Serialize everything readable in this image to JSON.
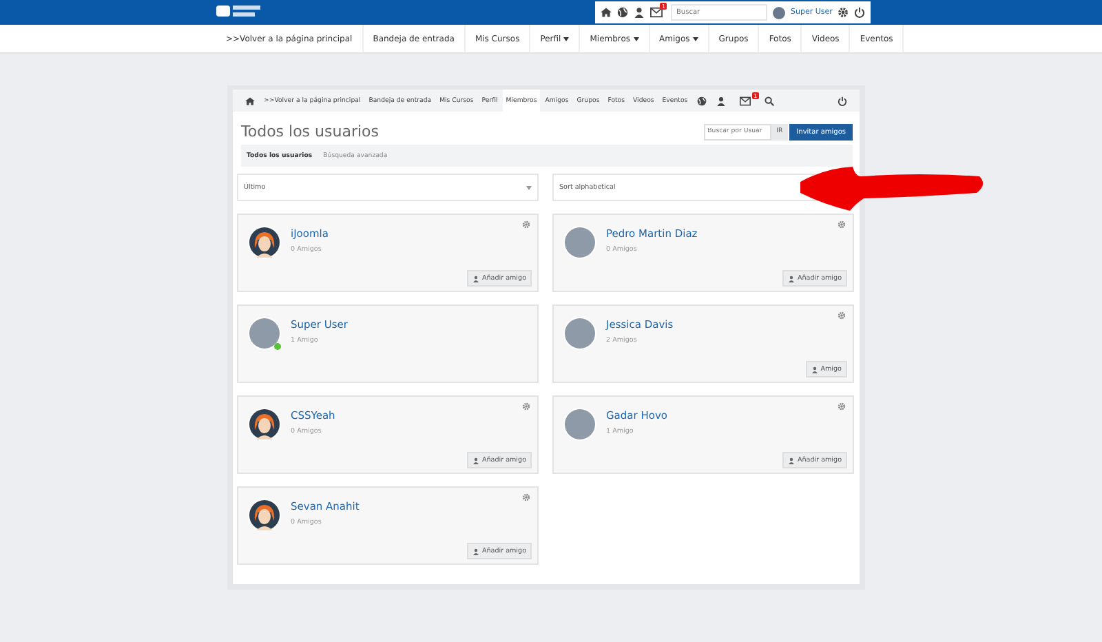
{
  "top_bar": {
    "search": {
      "placeholder": "Buscar"
    },
    "notification_count": "1",
    "user": "Super User"
  },
  "main_nav": [
    {
      "label": ">>Volver a la página principal",
      "caret": false
    },
    {
      "label": "Bandeja de entrada",
      "caret": false
    },
    {
      "label": "Mis Cursos",
      "caret": false
    },
    {
      "label": "Perfil",
      "caret": true
    },
    {
      "label": "Miembros",
      "caret": true
    },
    {
      "label": "Amigos",
      "caret": true
    },
    {
      "label": "Grupos",
      "caret": false
    },
    {
      "label": "Fotos",
      "caret": false
    },
    {
      "label": "Videos",
      "caret": false
    },
    {
      "label": "Eventos",
      "caret": false
    }
  ],
  "sub_nav": {
    "items": [
      {
        "label": ">>Volver a la página principal",
        "selected": false
      },
      {
        "label": "Bandeja de entrada",
        "selected": false
      },
      {
        "label": "Mis Cursos",
        "selected": false
      },
      {
        "label": "Perfil",
        "selected": false
      },
      {
        "label": "Miembros",
        "selected": true
      },
      {
        "label": "Amigos",
        "selected": false
      },
      {
        "label": "Grupos",
        "selected": false
      },
      {
        "label": "Fotos",
        "selected": false
      },
      {
        "label": "Videos",
        "selected": false
      },
      {
        "label": "Eventos",
        "selected": false
      }
    ],
    "notification_count": "1"
  },
  "page_title": "Todos los usuarios",
  "user_search": {
    "placeholder": "Buscar por Usuar",
    "go": "IR"
  },
  "invite_button": "Invitar amigos",
  "tabs": [
    {
      "label": "Todos los usuarios",
      "selected": true
    },
    {
      "label": "Búsqueda avanzada",
      "selected": false
    }
  ],
  "filters": [
    "Último",
    "Sort alphabetical"
  ],
  "members": [
    {
      "name": "iJoomla",
      "friends": "0 Amigos",
      "kind": "default",
      "online": false,
      "settings": true,
      "action": "Añadir amigo"
    },
    {
      "name": "Pedro Martin Diaz",
      "friends": "0 Amigos",
      "kind": "photo",
      "online": false,
      "settings": true,
      "action": "Añadir amigo"
    },
    {
      "name": "Super User",
      "friends": "1 Amigo",
      "kind": "photo",
      "online": true,
      "settings": false
    },
    {
      "name": "Jessica Davis",
      "friends": "2 Amigos",
      "kind": "photo",
      "online": false,
      "settings": true,
      "action": "Amigo"
    },
    {
      "name": "CSSYeah",
      "friends": "0 Amigos",
      "kind": "default",
      "online": false,
      "settings": true,
      "action": "Añadir amigo"
    },
    {
      "name": "Gadar Hovo",
      "friends": "1 Amigo",
      "kind": "photo",
      "online": false,
      "settings": true,
      "action": "Añadir amigo"
    },
    {
      "name": "Sevan Anahit",
      "friends": "0 Amigos",
      "kind": "default",
      "online": false,
      "settings": true,
      "action": "Añadir amigo"
    }
  ]
}
